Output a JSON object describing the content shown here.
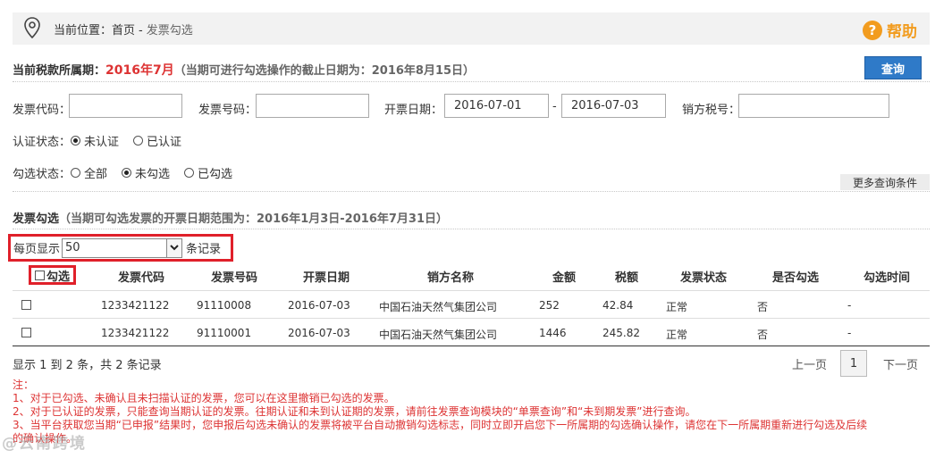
{
  "breadcrumb": {
    "prefix": "当前位置：",
    "home": "首页",
    "sep": "-",
    "current": "发票勾选"
  },
  "help": {
    "glyph": "?",
    "label": "帮助"
  },
  "period": {
    "label": "当前税款所属期：",
    "value": "2016年7月",
    "note": "（当期可进行勾选操作的截止日期为：2016年8月15日）"
  },
  "query_button": "查询",
  "filters": {
    "invoice_code_label": "发票代码：",
    "invoice_code_value": "",
    "invoice_number_label": "发票号码：",
    "invoice_number_value": "",
    "date_label": "开票日期：",
    "date_from": "2016-07-01",
    "date_sep": "-",
    "date_to": "2016-07-03",
    "seller_tax_label": "销方税号：",
    "seller_tax_value": ""
  },
  "cert_status": {
    "label": "认证状态：",
    "options": [
      {
        "label": "未认证",
        "selected": true
      },
      {
        "label": "已认证",
        "selected": false
      }
    ]
  },
  "select_status": {
    "label": "勾选状态：",
    "options": [
      {
        "label": "全部",
        "selected": false
      },
      {
        "label": "未勾选",
        "selected": true
      },
      {
        "label": "已勾选",
        "selected": false
      }
    ]
  },
  "more_conditions": "更多查询条件",
  "section": {
    "title": "发票勾选",
    "note": "（当期可勾选发票的开票日期范围为：2016年1月3日-2016年7月31日）"
  },
  "page_size": {
    "prefix": "每页显示",
    "value": "50",
    "suffix": "条记录"
  },
  "table": {
    "select_header": "勾选",
    "headers": [
      "发票代码",
      "发票号码",
      "开票日期",
      "销方名称",
      "金额",
      "税额",
      "发票状态",
      "是否勾选",
      "勾选时间"
    ],
    "rows": [
      [
        "1233421122",
        "91110008",
        "2016-07-03",
        "中国石油天然气集团公司",
        "252",
        "42.84",
        "正常",
        "否",
        "-"
      ],
      [
        "1233421122",
        "91110001",
        "2016-07-03",
        "中国石油天然气集团公司",
        "1446",
        "245.82",
        "正常",
        "否",
        "-"
      ]
    ]
  },
  "summary": "显示 1 到 2 条，共 2 条记录",
  "pager": {
    "prev": "上一页",
    "current": "1",
    "next": "下一页"
  },
  "notes": [
    "注：",
    "1、对于已勾选、未确认且未扫描认证的发票，您可以在这里撤销已勾选的发票。",
    "2、对于已认证的发票，只能查询当期认证的发票。往期认证和未到认证期的发票，请前往发票查询模块的“单票查询”和“未到期发票”进行查询。",
    "3、当平台获取您当期“已申报”结果时，您申报后勾选未确认的发票将被平台自动撤销勾选标志，同时立即开启您下一所属期的勾选确认操作，请您在下一所属期重新进行勾选及后续",
    "的确认操作。"
  ],
  "watermark": "@云南跨境",
  "colors": {
    "accent_blue": "#2f7ac8",
    "alert_red": "#d33",
    "help_orange": "#f29c1f",
    "highlight_red": "#e0202a"
  }
}
